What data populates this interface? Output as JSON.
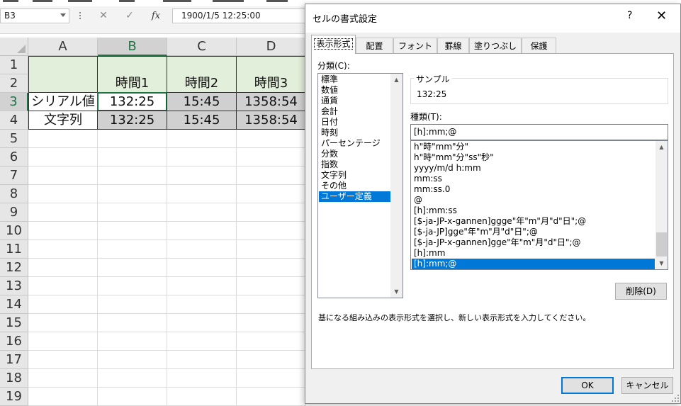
{
  "formula_bar": {
    "name_box": "B3",
    "cancel_symbol": "✕",
    "enter_symbol": "✓",
    "fx_symbol": "fx",
    "formula": "1900/1/5  12:25:00"
  },
  "sheet": {
    "columns": [
      "A",
      "B",
      "C",
      "D"
    ],
    "rows": [
      "1",
      "2",
      "3",
      "4",
      "5",
      "6",
      "7",
      "8",
      "9",
      "10",
      "11",
      "12",
      "13",
      "14",
      "15",
      "16",
      "17",
      "18",
      "19"
    ],
    "headers": [
      "時間1",
      "時間2",
      "時間3"
    ],
    "row_labels": [
      "シリアル値",
      "文字列"
    ],
    "serial_values": [
      "132:25",
      "15:45",
      "1358:54"
    ],
    "text_values": [
      "132:25",
      "15:45",
      "1358:54"
    ]
  },
  "dialog": {
    "title": "セルの書式設定",
    "help": "?",
    "close": "✕",
    "tabs": [
      "表示形式",
      "配置",
      "フォント",
      "罫線",
      "塗りつぶし",
      "保護"
    ],
    "category_label": "分類(C):",
    "categories": [
      "標準",
      "数値",
      "通貨",
      "会計",
      "日付",
      "時刻",
      "パーセンテージ",
      "分数",
      "指数",
      "文字列",
      "その他",
      "ユーザー定義"
    ],
    "selected_category": "ユーザー定義",
    "sample_label": "サンプル",
    "sample_value": "132:25",
    "type_label": "種類(T):",
    "type_value": "[h]:mm;@",
    "formats": [
      "h\"時\"mm\"分\"",
      "h\"時\"mm\"分\"ss\"秒\"",
      "yyyy/m/d h:mm",
      "mm:ss",
      "mm:ss.0",
      "@",
      "[h]:mm:ss",
      "[$-ja-JP-x-gannen]ggge\"年\"m\"月\"d\"日\";@",
      "[$-ja-JP]gge\"年\"m\"月\"d\"日\";@",
      "[$-ja-JP-x-gannen]gge\"年\"m\"月\"d\"日\";@",
      "[h]:mm",
      "[h]:mm;@"
    ],
    "selected_format": "[h]:mm;@",
    "delete_button": "削除(D)",
    "description": "基になる組み込みの表示形式を選択し、新しい表示形式を入力してください。",
    "ok_button": "OK",
    "cancel_button": "キャンセル"
  }
}
